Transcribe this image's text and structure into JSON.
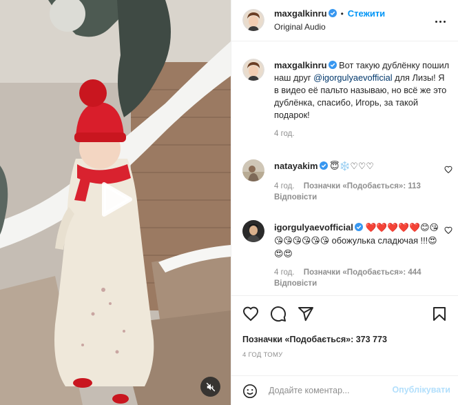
{
  "header": {
    "username": "maxgalkinru",
    "follow_label": "Стежити",
    "subtitle": "Original Audio",
    "separator": "•"
  },
  "caption": {
    "username": "maxgalkinru",
    "text_before": " Вот такую дублёнку пошил наш друг ",
    "mention": "@igorgulyaevofficial",
    "text_after": " для Лизы! Я в видео её пальто называю, но всё же это дублёнка, спасибо, Игорь, за такой подарок!",
    "time": "4 год."
  },
  "comments": [
    {
      "username": "natayakim",
      "text": "😇❄️♡♡♡",
      "time": "4 год.",
      "likes": "Позначки «Подобається»: 113",
      "reply": "Відповісти"
    },
    {
      "username": "igorgulyaevofficial",
      "text": "❤️❤️❤️❤️❤️😊😘😘😘😘😘😘😘 обожулька сладючая !!!😍😍😍",
      "time": "4 год.",
      "likes": "Позначки «Подобається»: 444",
      "reply": "Відповісти"
    }
  ],
  "actions": {
    "likes_text": "Позначки «Подобається»: 373 773",
    "timestamp": "4 ГОД ТОМУ"
  },
  "add_comment": {
    "placeholder": "Додайте коментар...",
    "post_label": "Опублікувати"
  },
  "icons": {
    "verified": "verified-badge-icon",
    "more": "more-options-icon",
    "like": "heart-icon",
    "comment": "comment-icon",
    "share": "share-icon",
    "save": "bookmark-icon",
    "emoji": "emoji-icon",
    "play": "play-icon",
    "mute": "muted-speaker-icon"
  },
  "colors": {
    "accent": "#0095f6",
    "verified": "#3897f0",
    "muted_text": "#8e8e8e",
    "mention": "#00376b",
    "post_disabled": "#b2dffc"
  }
}
